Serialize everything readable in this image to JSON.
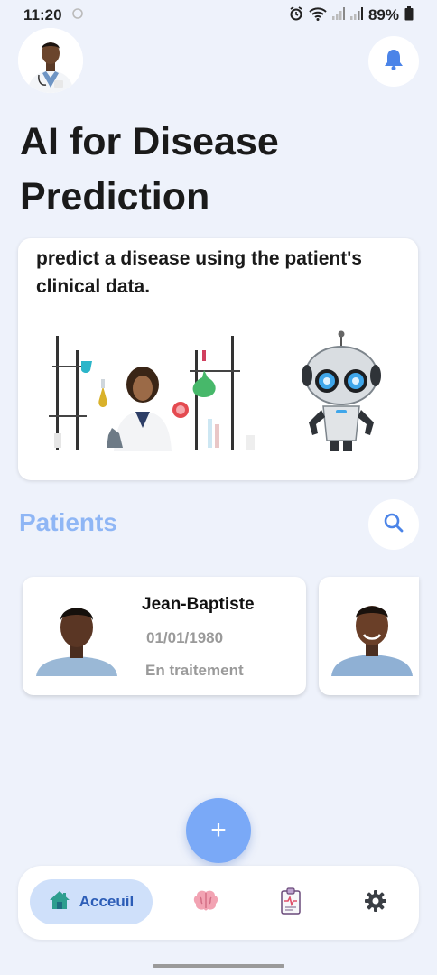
{
  "status_bar": {
    "time": "11:20",
    "battery": "89%",
    "icons": [
      "alarm-icon",
      "wifi-icon",
      "signal-icon",
      "signal-icon",
      "battery-icon"
    ]
  },
  "header": {
    "avatar": "doctor-avatar",
    "notification_icon": "bell-icon",
    "title": "AI for Disease Prediction"
  },
  "hero": {
    "description": "predict a disease using the patient's clinical data.",
    "images": [
      "lab-scientist-illustration",
      "robot-illustration"
    ]
  },
  "patients": {
    "section_title": "Patients",
    "search_icon": "search-icon",
    "items": [
      {
        "name": "Jean-Baptiste",
        "dob": "01/01/1980",
        "status": "En traitement"
      },
      {
        "name": "",
        "dob": "",
        "status": ""
      }
    ]
  },
  "fab": {
    "icon": "plus-icon",
    "label": "+"
  },
  "bottom_nav": {
    "items": [
      {
        "label": "Acceuil",
        "icon": "home-icon",
        "active": true
      },
      {
        "label": "",
        "icon": "brain-icon",
        "active": false
      },
      {
        "label": "",
        "icon": "clipboard-report-icon",
        "active": false
      },
      {
        "label": "",
        "icon": "gear-icon",
        "active": false
      }
    ]
  },
  "colors": {
    "background": "#eef2fb",
    "accent": "#7aa9f7",
    "section_title": "#8fb6f5",
    "nav_active_bg": "#cfe0fa",
    "nav_active_text": "#2c5db7"
  }
}
